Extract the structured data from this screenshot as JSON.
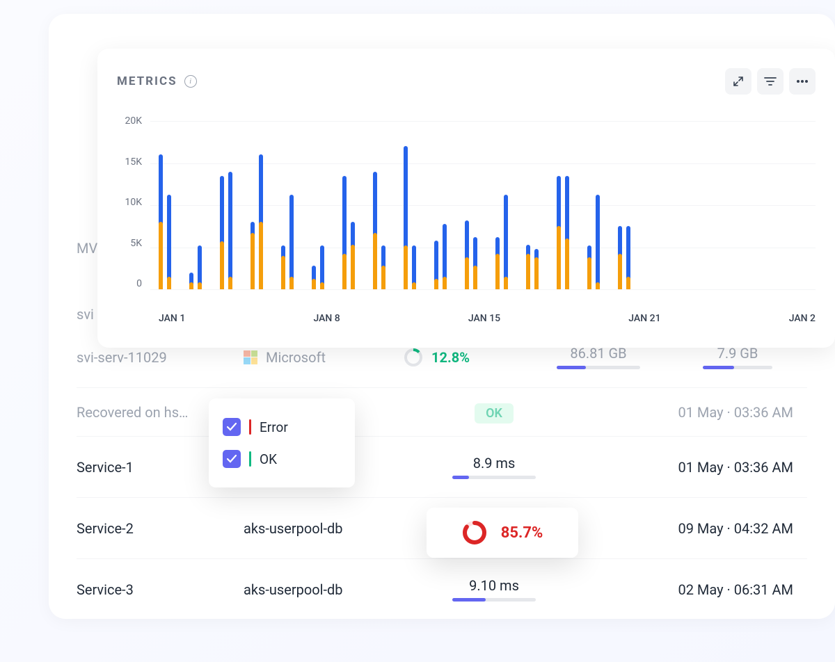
{
  "panel": {
    "title": "METRICS"
  },
  "partials": {
    "mw": "MV",
    "svi": "svi"
  },
  "chart_data": {
    "type": "bar",
    "title": "METRICS",
    "ylabel": "",
    "xlabel": "",
    "y_ticks": [
      "20K",
      "15K",
      "10K",
      "5K",
      "0"
    ],
    "x_ticks": [
      "JAN 1",
      "JAN 8",
      "JAN 15",
      "JAN 21",
      "JAN 2"
    ],
    "ylim": [
      0,
      20000
    ],
    "series": [
      {
        "name": "Error",
        "color": "#dc2626"
      },
      {
        "name": "OK",
        "color": "#10b981"
      }
    ],
    "stacked_pairs": [
      {
        "a_total": 16000,
        "a_low": 8000,
        "b_total": 11200,
        "b_low": 1500
      },
      {
        "a_total": 2000,
        "a_low": 800,
        "b_total": 5200,
        "b_low": 800
      },
      {
        "a_total": 13500,
        "a_low": 5700,
        "b_total": 14000,
        "b_low": 1500
      },
      {
        "a_total": 8000,
        "a_low": 6700,
        "b_total": 16000,
        "b_low": 8000
      },
      {
        "a_total": 5200,
        "a_low": 4000,
        "b_total": 11200,
        "b_low": 1500
      },
      {
        "a_total": 2800,
        "a_low": 1200,
        "b_total": 5200,
        "b_low": 800
      },
      {
        "a_total": 13500,
        "a_low": 4200,
        "b_total": 8000,
        "b_low": 5300
      },
      {
        "a_total": 14000,
        "a_low": 6700,
        "b_total": 5200,
        "b_low": 2800
      },
      {
        "a_total": 17000,
        "a_low": 5200,
        "b_total": 5200,
        "b_low": 800
      },
      {
        "a_total": 5800,
        "a_low": 1200,
        "b_total": 7800,
        "b_low": 1500
      },
      {
        "a_total": 8200,
        "a_low": 3800,
        "b_total": 6200,
        "b_low": 2800
      },
      {
        "a_total": 6200,
        "a_low": 4200,
        "b_total": 11200,
        "b_low": 1500
      },
      {
        "a_total": 5300,
        "a_low": 4200,
        "b_total": 4800,
        "b_low": 3800
      },
      {
        "a_total": 13500,
        "a_low": 7500,
        "b_total": 13500,
        "b_low": 6000
      },
      {
        "a_total": 5200,
        "a_low": 3800,
        "b_total": 11200,
        "b_low": 800
      },
      {
        "a_total": 7500,
        "a_low": 4200,
        "b_total": 7500,
        "b_low": 1500
      }
    ]
  },
  "legend": {
    "items": [
      {
        "label": "Error",
        "color": "#dc2626",
        "checked": true
      },
      {
        "label": "OK",
        "color": "#10b981",
        "checked": true
      }
    ]
  },
  "popup": {
    "percent": "85.7%"
  },
  "rows": [
    {
      "name": "svi-serv-11029",
      "provider": "Microsoft",
      "percent": "12.8%",
      "percent_color": "#10b981",
      "val1": "86.81 GB",
      "val2": "7.9 GB",
      "faded": true
    },
    {
      "name": "Recovered on hs…",
      "provider": "",
      "status": "OK",
      "time": "01 May · 03:36 AM",
      "faded": true
    },
    {
      "name": "Service-1",
      "provider": "",
      "ms": "8.9 ms",
      "bar_pct": 20,
      "time": "01 May · 03:36 AM"
    },
    {
      "name": "Service-2",
      "provider": "aks-userpool-db",
      "time": "09 May · 04:32 AM"
    },
    {
      "name": "Service-3",
      "provider": "aks-userpool-db",
      "ms": "9.10 ms",
      "bar_pct": 40,
      "time": "02 May · 06:31 AM"
    }
  ]
}
